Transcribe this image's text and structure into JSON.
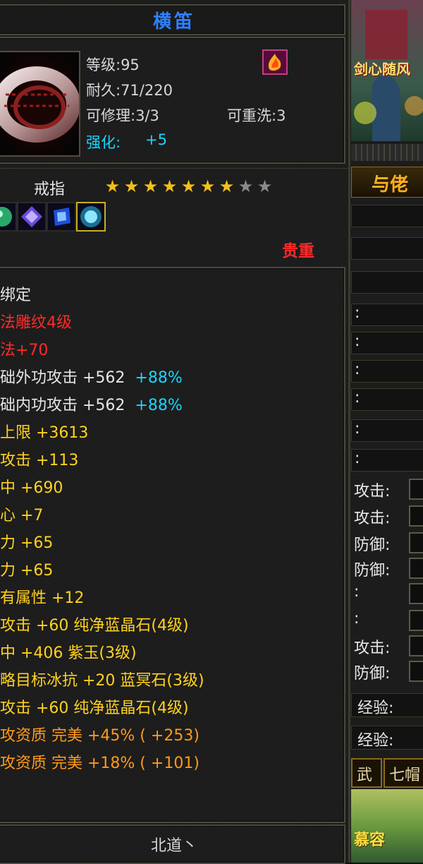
{
  "item": {
    "name": "横笛",
    "level_label": "等级:95",
    "durability_label": "耐久:71/220",
    "repairable_label": "可修理:3/3",
    "rewashable_label": "可重洗:3",
    "enhance_label": "强化:",
    "enhance_value": "+5",
    "type": "戒指",
    "stars_filled": 7,
    "stars_total": 9,
    "rarity": "贵重",
    "gem_icons": [
      "green-gem-icon",
      "purple-gem-icon",
      "blue-gem-icon",
      "cyan-gem-icon"
    ]
  },
  "stats": [
    {
      "text": "绑定",
      "color": "w"
    },
    {
      "text": "法雕纹4级",
      "color": "r"
    },
    {
      "text": "法+70",
      "color": "r"
    },
    {
      "text": "础外功攻击 +562",
      "extra": "+88%",
      "color": "w"
    },
    {
      "text": "础内功攻击 +562",
      "extra": "+88%",
      "color": "w"
    },
    {
      "text": "上限 +3613",
      "color": "y"
    },
    {
      "text": "攻击 +113",
      "color": "y"
    },
    {
      "text": "中 +690",
      "color": "y"
    },
    {
      "text": "心 +7",
      "color": "y"
    },
    {
      "text": "力 +65",
      "color": "y"
    },
    {
      "text": "力 +65",
      "color": "y"
    },
    {
      "text": "有属性 +12",
      "color": "y"
    },
    {
      "text": "攻击 +60 纯净蓝晶石(4级)",
      "color": "y"
    },
    {
      "text": "中 +406 紫玉(3级)",
      "color": "y"
    },
    {
      "text": "略目标冰抗 +20 蓝冥石(3级)",
      "color": "y"
    },
    {
      "text": "攻击 +60 纯净蓝晶石(4级)",
      "color": "y"
    },
    {
      "text": "攻资质  完美 +45% ( +253)",
      "color": "o"
    },
    {
      "text": "攻资质  完美 +18% ( +101)",
      "color": "o"
    }
  ],
  "footer": "北道丶",
  "right_panel": {
    "banner_text": "剑心随风",
    "tab_label": "与佬",
    "colons": [
      ":",
      ":",
      ":",
      ":",
      ":",
      ":"
    ],
    "attr_rows": [
      {
        "label": "攻击:"
      },
      {
        "label": "攻击:"
      },
      {
        "label": "防御:"
      },
      {
        "label": "防御:"
      },
      {
        "label": ":"
      },
      {
        "label": ":"
      },
      {
        "label": "攻击:"
      },
      {
        "label": "防御:"
      }
    ],
    "exp_rows": [
      "经验:",
      "经验:"
    ],
    "bottom_buttons": [
      "武",
      "七帽"
    ],
    "bottom_name": "慕容"
  }
}
